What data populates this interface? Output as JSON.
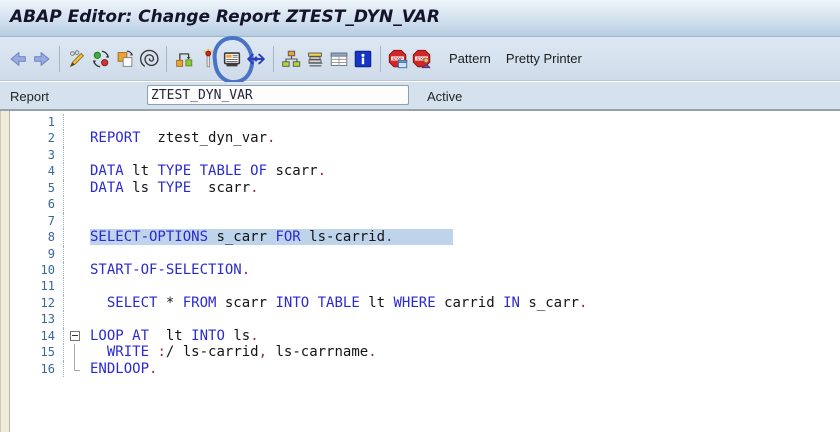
{
  "window": {
    "title": "ABAP Editor: Change Report ZTEST_DYN_VAR"
  },
  "toolbar": {
    "groups": [
      [
        "back-icon",
        "forward-icon"
      ],
      [
        "display-change-icon",
        "other-object-icon",
        "copy-icon",
        "check-icon"
      ],
      [
        "assign-icon",
        "activate-icon",
        "test-icon",
        "where-used-icon"
      ],
      [
        "object-list-icon",
        "nav-stack-icon",
        "table-view-icon",
        "info-icon"
      ],
      [
        "breakpoint-icon",
        "watchpoint-icon"
      ]
    ],
    "annotated_icon": "test-icon",
    "pattern_label": "Pattern",
    "pretty_printer_label": "Pretty Printer"
  },
  "report_bar": {
    "label": "Report",
    "value": "ZTEST_DYN_VAR",
    "status": "Active"
  },
  "editor": {
    "lines": [
      {
        "n": 1,
        "segs": []
      },
      {
        "n": 2,
        "segs": [
          {
            "t": "REPORT",
            "c": "k"
          },
          {
            "t": "  ztest_dyn_var",
            "c": "i"
          },
          {
            "t": ".",
            "c": "p"
          }
        ]
      },
      {
        "n": 3,
        "segs": []
      },
      {
        "n": 4,
        "segs": [
          {
            "t": "DATA",
            "c": "k"
          },
          {
            "t": " lt ",
            "c": "i"
          },
          {
            "t": "TYPE TABLE OF",
            "c": "k"
          },
          {
            "t": " scarr",
            "c": "i"
          },
          {
            "t": ".",
            "c": "p"
          }
        ]
      },
      {
        "n": 5,
        "segs": [
          {
            "t": "DATA",
            "c": "k"
          },
          {
            "t": " ls ",
            "c": "i"
          },
          {
            "t": "TYPE",
            "c": "k"
          },
          {
            "t": "  scarr",
            "c": "i"
          },
          {
            "t": ".",
            "c": "p"
          }
        ]
      },
      {
        "n": 6,
        "segs": []
      },
      {
        "n": 7,
        "segs": []
      },
      {
        "n": 8,
        "hl": true,
        "segs": [
          {
            "t": "SELECT-OPTIONS",
            "c": "k"
          },
          {
            "t": " s_carr ",
            "c": "i"
          },
          {
            "t": "FOR",
            "c": "k"
          },
          {
            "t": " ls-carrid",
            "c": "i"
          },
          {
            "t": ".",
            "c": "p"
          },
          {
            "t": "       ",
            "c": "i"
          }
        ]
      },
      {
        "n": 9,
        "segs": []
      },
      {
        "n": 10,
        "segs": [
          {
            "t": "START-OF-SELECTION",
            "c": "k"
          },
          {
            "t": ".",
            "c": "p"
          }
        ]
      },
      {
        "n": 11,
        "segs": []
      },
      {
        "n": 12,
        "segs": [
          {
            "t": "  ",
            "c": "i"
          },
          {
            "t": "SELECT",
            "c": "k"
          },
          {
            "t": " * ",
            "c": "i"
          },
          {
            "t": "FROM",
            "c": "k"
          },
          {
            "t": " scarr ",
            "c": "i"
          },
          {
            "t": "INTO TABLE",
            "c": "k"
          },
          {
            "t": " lt ",
            "c": "i"
          },
          {
            "t": "WHERE",
            "c": "k"
          },
          {
            "t": " carrid ",
            "c": "i"
          },
          {
            "t": "IN",
            "c": "k"
          },
          {
            "t": " s_carr",
            "c": "i"
          },
          {
            "t": ".",
            "c": "p"
          }
        ]
      },
      {
        "n": 13,
        "segs": []
      },
      {
        "n": 14,
        "fold": "start",
        "segs": [
          {
            "t": "LOOP AT",
            "c": "k"
          },
          {
            "t": "  lt ",
            "c": "i"
          },
          {
            "t": "INTO",
            "c": "k"
          },
          {
            "t": " ls",
            "c": "i"
          },
          {
            "t": ".",
            "c": "p"
          }
        ]
      },
      {
        "n": 15,
        "fold": "mid",
        "segs": [
          {
            "t": "  ",
            "c": "i"
          },
          {
            "t": "WRITE",
            "c": "k"
          },
          {
            "t": " ",
            "c": "i"
          },
          {
            "t": ":",
            "c": "p"
          },
          {
            "t": "/ ls-carrid",
            "c": "i"
          },
          {
            "t": ",",
            "c": "p"
          },
          {
            "t": " ls-carrname",
            "c": "i"
          },
          {
            "t": ".",
            "c": "p"
          }
        ]
      },
      {
        "n": 16,
        "fold": "end",
        "segs": [
          {
            "t": "ENDLOOP",
            "c": "k"
          },
          {
            "t": ".",
            "c": "p"
          }
        ]
      }
    ]
  },
  "colors": {
    "keyword": "#2a2ad0",
    "identifier": "#141414",
    "punctuation": "#8b2962",
    "line_number": "#38679f",
    "statement_highlight": "#bed4ea",
    "annotation_circle": "#4b73c5"
  }
}
